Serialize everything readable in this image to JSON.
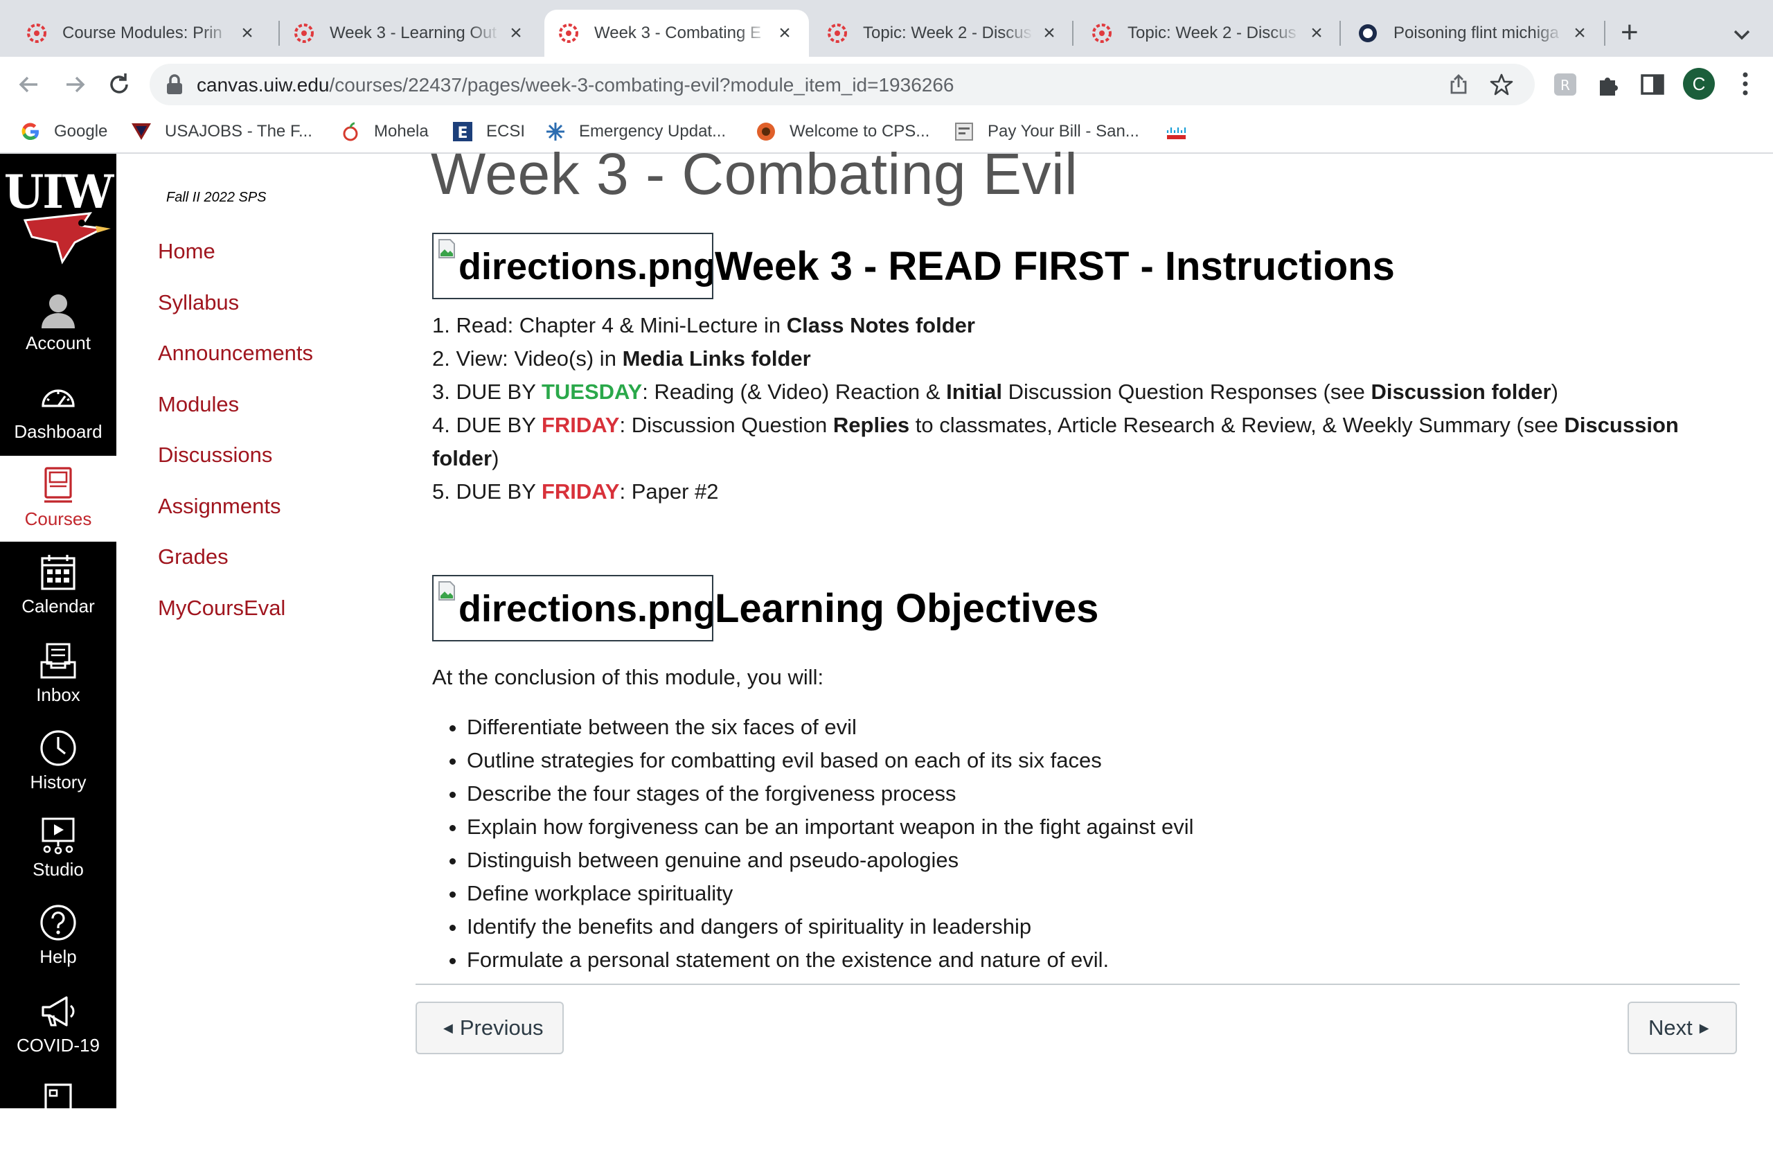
{
  "browser": {
    "tabs": [
      {
        "title": "Course Modules: Prin",
        "active": false
      },
      {
        "title": "Week 3 - Learning Out",
        "active": false
      },
      {
        "title": "Week 3 - Combating E",
        "active": true
      },
      {
        "title": "Topic: Week 2 - Discus",
        "active": false
      },
      {
        "title": "Topic: Week 2 - Discus",
        "active": false
      },
      {
        "title": "Poisoning flint michiga",
        "active": false
      }
    ],
    "new_tab_label": "+",
    "url_host": "canvas.uiw.edu",
    "url_path": "/courses/22437/pages/week-3-combating-evil?module_item_id=1936266",
    "profile_initial": "C",
    "bookmarks": [
      {
        "label": "Google",
        "icon": "google-icon"
      },
      {
        "label": "USAJOBS - The F...",
        "icon": "usajobs-icon"
      },
      {
        "label": "Mohela",
        "icon": "mohela-icon"
      },
      {
        "label": "ECSI",
        "icon": "ecsi-icon"
      },
      {
        "label": "Emergency Updat...",
        "icon": "emergency-icon"
      },
      {
        "label": "Welcome to CPS...",
        "icon": "cps-icon"
      },
      {
        "label": "Pay Your Bill - San...",
        "icon": "bill-icon"
      },
      {
        "label": "",
        "icon": "cisco-icon"
      }
    ]
  },
  "global_nav": {
    "items": [
      {
        "label": "Account",
        "icon": "account-icon"
      },
      {
        "label": "Dashboard",
        "icon": "dashboard-icon"
      },
      {
        "label": "Courses",
        "icon": "courses-icon",
        "active": true
      },
      {
        "label": "Calendar",
        "icon": "calendar-icon"
      },
      {
        "label": "Inbox",
        "icon": "inbox-icon"
      },
      {
        "label": "History",
        "icon": "history-icon"
      },
      {
        "label": "Studio",
        "icon": "studio-icon"
      },
      {
        "label": "Help",
        "icon": "help-icon"
      },
      {
        "label": "COVID-19",
        "icon": "megaphone-icon"
      }
    ]
  },
  "course_nav": {
    "term": "Fall II 2022 SPS",
    "items": [
      "Home",
      "Syllabus",
      "Announcements",
      "Modules",
      "Discussions",
      "Assignments",
      "Grades",
      "MyCoursEval"
    ]
  },
  "page": {
    "title": "Week 3 - Combating Evil",
    "image_alt": "directions.png",
    "instructions_heading": "Week 3 - READ FIRST - Instructions",
    "instructions": {
      "item1": {
        "prefix": "1. Read: Chapter 4 & Mini-Lecture in ",
        "bold": "Class Notes folder"
      },
      "item2": {
        "prefix": "2. View: Video(s) in ",
        "bold": "Media Links folder"
      },
      "item3": {
        "prefix": "3. DUE BY ",
        "due": "TUESDAY",
        "mid1": ": Reading (& Video) Reaction & ",
        "bold1": "Initial",
        "mid2": " Discussion Question Responses (see ",
        "bold2": "Discussion folder",
        "suffix": ")"
      },
      "item4": {
        "prefix": "4. DUE BY ",
        "due": "FRIDAY",
        "mid1": ": Discussion Question ",
        "bold1": "Replies",
        "mid2": " to classmates, Article Research & Review, & Weekly Summary (see ",
        "bold2": "Discussion folder",
        "suffix": ")"
      },
      "item5": {
        "prefix": "5. DUE BY ",
        "due": "FRIDAY",
        "suffix": ": Paper #2"
      }
    },
    "objectives_heading": "Learning Objectives",
    "objectives_intro": "At the conclusion of this module, you will:",
    "objectives": [
      "Differentiate between the six faces of evil",
      "Outline strategies for combatting evil based on each of its six faces",
      "Describe the four stages of the forgiveness process",
      "Explain how forgiveness can be an important weapon in the fight against evil",
      "Distinguish between genuine and pseudo-apologies",
      "Define workplace spirituality",
      "Identify the benefits and dangers of spirituality in leadership",
      "Formulate a personal statement on the existence and nature of evil."
    ],
    "prev_label": "Previous",
    "next_label": "Next"
  },
  "colors": {
    "brand_red": "#a0151e",
    "tuesday_green": "#2aa84a",
    "friday_red": "#d8313a",
    "nav_bg": "#000000"
  }
}
